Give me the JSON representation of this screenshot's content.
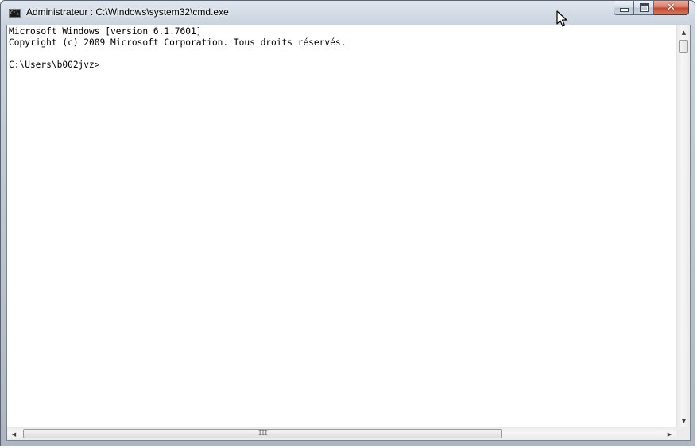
{
  "window": {
    "title": "Administrateur : C:\\Windows\\system32\\cmd.exe",
    "icon": "console-icon",
    "icon_text": "C:\\",
    "caption_buttons": {
      "minimize": "minimize-icon",
      "maximize": "maximize-icon",
      "close_glyph": "✕"
    }
  },
  "console": {
    "lines": [
      "Microsoft Windows [version 6.1.7601]",
      "Copyright (c) 2009 Microsoft Corporation. Tous droits réservés.",
      "",
      "C:\\Users\\b002jvz>"
    ],
    "background": "#ffffff",
    "text_color": "#000000"
  },
  "scrollbars": {
    "up_arrow": "▲",
    "down_arrow": "▼",
    "left_arrow": "◀",
    "right_arrow": "▶",
    "grip": "III"
  }
}
